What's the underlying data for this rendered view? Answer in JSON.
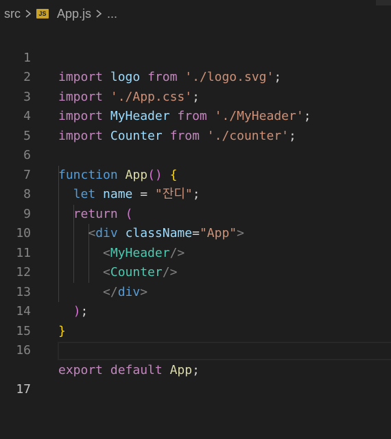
{
  "breadcrumb": {
    "folder": "src",
    "file_icon_text": "JS",
    "file": "App.js",
    "more": "..."
  },
  "colors": {
    "background": "#1e1e1e",
    "keyword": "#c586c0",
    "string": "#ce9178",
    "function": "#dcdcaa",
    "variable": "#9cdcfe",
    "storage": "#569cd6",
    "component": "#4ec9b0",
    "tag_bracket": "#808080",
    "bracket_gold": "#ffd700",
    "bracket_orchid": "#da70d6",
    "line_number": "#858585"
  },
  "editor": {
    "active_line": 17,
    "lines": [
      {
        "n": "1",
        "t": [
          "import",
          " ",
          "logo",
          " ",
          "from",
          " ",
          "'./logo.svg'",
          ";"
        ]
      },
      {
        "n": "2",
        "t": [
          "import",
          " ",
          "'./App.css'",
          ";"
        ]
      },
      {
        "n": "3",
        "t": [
          "import",
          " ",
          "MyHeader",
          " ",
          "from",
          " ",
          "'./MyHeader'",
          ";"
        ]
      },
      {
        "n": "4",
        "t": [
          "import",
          " ",
          "Counter",
          " ",
          "from",
          " ",
          "'./counter'",
          ";"
        ]
      },
      {
        "n": "5",
        "t": []
      },
      {
        "n": "6",
        "t": [
          "function",
          " ",
          "App",
          "()",
          " ",
          "{"
        ]
      },
      {
        "n": "7",
        "t": [
          "  ",
          "let",
          " ",
          "name",
          " = ",
          "\"잔디\"",
          ";"
        ]
      },
      {
        "n": "8",
        "t": [
          "  ",
          "return",
          " ",
          "("
        ]
      },
      {
        "n": "9",
        "t": [
          "    ",
          "<",
          "div",
          " ",
          "className",
          "=",
          "\"App\"",
          ">"
        ]
      },
      {
        "n": "10",
        "t": [
          "      ",
          "<",
          "MyHeader",
          "/>"
        ]
      },
      {
        "n": "11",
        "t": [
          "      ",
          "<",
          "Counter",
          "/>"
        ]
      },
      {
        "n": "12",
        "t": [
          "      ",
          "</",
          "div",
          ">"
        ]
      },
      {
        "n": "13",
        "t": [
          "  ",
          ")",
          ";"
        ]
      },
      {
        "n": "14",
        "t": [
          "}"
        ]
      },
      {
        "n": "15",
        "t": []
      },
      {
        "n": "16",
        "t": [
          "export",
          " ",
          "default",
          " ",
          "App",
          ";"
        ]
      },
      {
        "n": "17",
        "t": []
      }
    ]
  }
}
